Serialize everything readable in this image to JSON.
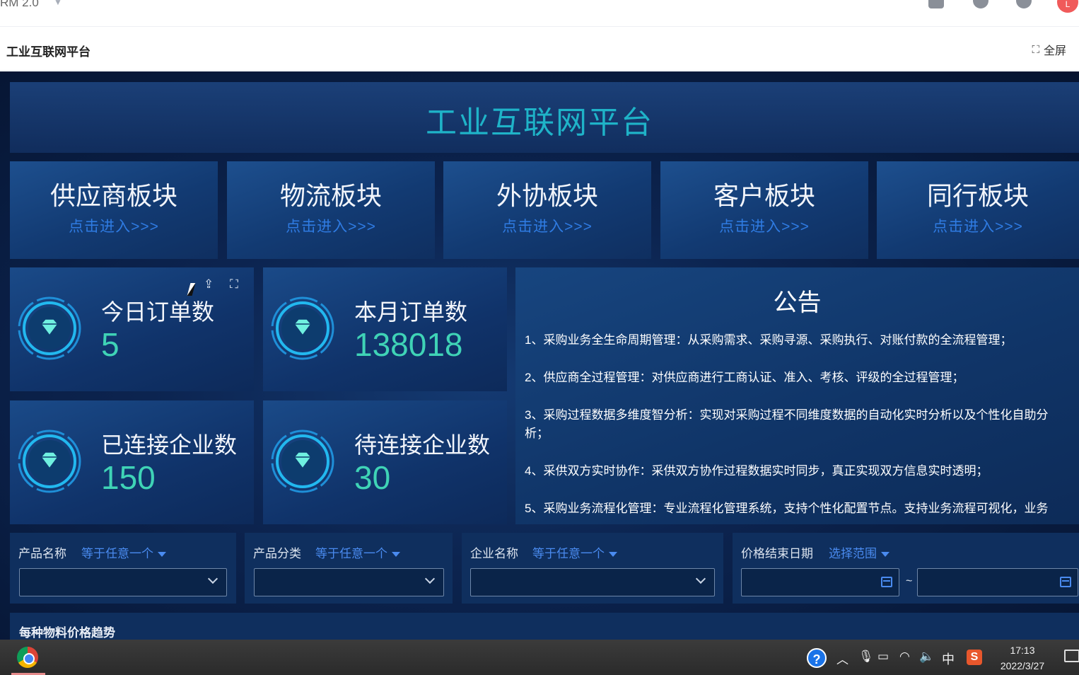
{
  "app": {
    "title": "RM 2.0"
  },
  "top_icons": [
    "doc-icon",
    "bell-icon",
    "help-icon",
    "avatar"
  ],
  "avatar_letter": "L",
  "page": {
    "title": "工业互联网平台",
    "fullscreen_label": "全屏"
  },
  "banner": {
    "title": "工业互联网平台"
  },
  "modules": [
    {
      "title": "供应商板块",
      "link": "点击进入>>>"
    },
    {
      "title": "物流板块",
      "link": "点击进入>>>"
    },
    {
      "title": "外协板块",
      "link": "点击进入>>>"
    },
    {
      "title": "客户板块",
      "link": "点击进入>>>"
    },
    {
      "title": "同行板块",
      "link": "点击进入>>>"
    }
  ],
  "stats": [
    {
      "label": "今日订单数",
      "value": "5"
    },
    {
      "label": "本月订单数",
      "value": "138018"
    },
    {
      "label": "已连接企业数",
      "value": "150"
    },
    {
      "label": "待连接企业数",
      "value": "30"
    }
  ],
  "notice": {
    "title": "公告",
    "items": [
      "1、采购业务全生命周期管理：从采购需求、采购寻源、采购执行、对账付款的全流程管理；",
      "2、供应商全过程管理：对供应商进行工商认证、准入、考核、评级的全过程管理；",
      "3、采购过程数据多维度智分析：实现对采购过程不同维度数据的自动化实时分析以及个性化自助分析；",
      "4、采供双方实时协作：采供双方协作过程数据实时同步，真正实现双方信息实时透明；",
      "5、采购业务流程化管理：专业流程化管理系统，支持个性化配置节点。支持业务流程可视化，业务"
    ]
  },
  "filters": [
    {
      "label": "产品名称",
      "op": "等于任意一个"
    },
    {
      "label": "产品分类",
      "op": "等于任意一个"
    },
    {
      "label": "企业名称",
      "op": "等于任意一个"
    },
    {
      "label": "价格结束日期",
      "op": "选择范围",
      "range_sep": "~"
    }
  ],
  "chart_section": {
    "title": "每种物料价格趋势"
  },
  "taskbar": {
    "ime": "中",
    "time": "17:13",
    "date": "2022/3/27"
  }
}
